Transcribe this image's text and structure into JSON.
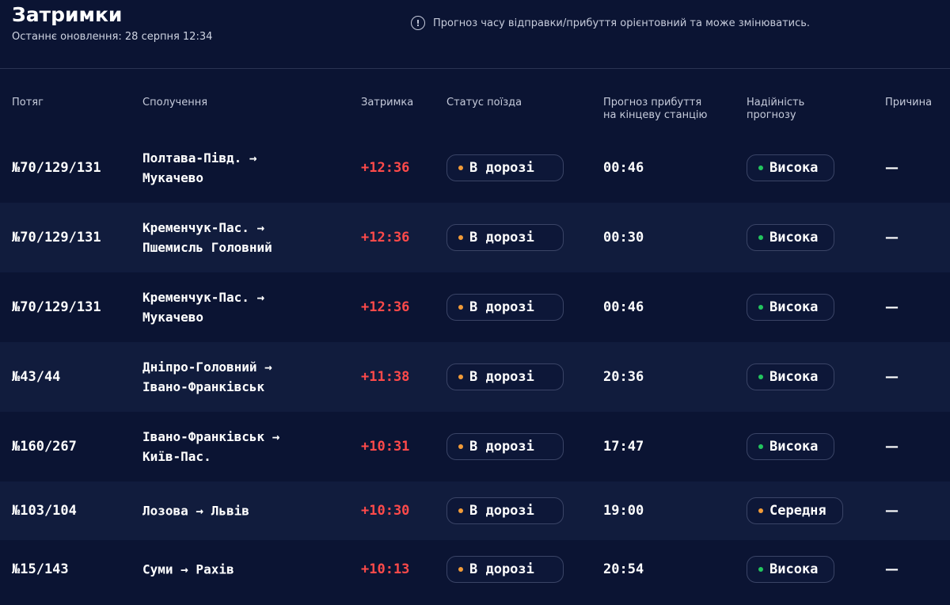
{
  "header": {
    "title": "Затримки",
    "updated": "Останнє оновлення: 28 серпня 12:34",
    "note": "Прогноз часу відправки/прибуття орієнтовний та може змінюватись.",
    "info_icon": "!"
  },
  "columns": {
    "train": "Потяг",
    "route": "Сполучення",
    "delay": "Затримка",
    "status": "Статус поїзда",
    "eta_line1": "Прогноз прибуття",
    "eta_line2": "на кінцеву станцію",
    "reliability_line1": "Надійність",
    "reliability_line2": "прогнозу",
    "reason": "Причина"
  },
  "colors": {
    "status_dot": "#f29b38",
    "high": "#22c55e",
    "medium": "#f29b38"
  },
  "rows": [
    {
      "train": "№70/129/131",
      "route": "Полтава-Півд. → Мукачево",
      "route1": "Полтава-Півд. →",
      "route2": "Мукачево",
      "delay": "+12:36",
      "status": "В дорозі",
      "eta": "00:46",
      "reliability": "Висока",
      "rel_level": "high",
      "reason": "—"
    },
    {
      "train": "№70/129/131",
      "route": "Кременчук-Пас. → Пшемисль Головний",
      "route1": "Кременчук-Пас. →",
      "route2": "Пшемисль Головний",
      "delay": "+12:36",
      "status": "В дорозі",
      "eta": "00:30",
      "reliability": "Висока",
      "rel_level": "high",
      "reason": "—"
    },
    {
      "train": "№70/129/131",
      "route": "Кременчук-Пас. → Мукачево",
      "route1": "Кременчук-Пас. →",
      "route2": "Мукачево",
      "delay": "+12:36",
      "status": "В дорозі",
      "eta": "00:46",
      "reliability": "Висока",
      "rel_level": "high",
      "reason": "—"
    },
    {
      "train": "№43/44",
      "route": "Дніпро-Головний → Івано-Франківськ",
      "route1": "Дніпро-Головний →",
      "route2": "Івано-Франківськ",
      "delay": "+11:38",
      "status": "В дорозі",
      "eta": "20:36",
      "reliability": "Висока",
      "rel_level": "high",
      "reason": "—"
    },
    {
      "train": "№160/267",
      "route": "Івано-Франківськ → Київ-Пас.",
      "route1": "Івано-Франківськ →",
      "route2": "Київ-Пас.",
      "delay": "+10:31",
      "status": "В дорозі",
      "eta": "17:47",
      "reliability": "Висока",
      "rel_level": "high",
      "reason": "—"
    },
    {
      "train": "№103/104",
      "route": "Лозова → Львів",
      "route1": "Лозова → Львів",
      "route2": "",
      "delay": "+10:30",
      "status": "В дорозі",
      "eta": "19:00",
      "reliability": "Середня",
      "rel_level": "medium",
      "reason": "—"
    },
    {
      "train": "№15/143",
      "route": "Суми → Рахів",
      "route1": "Суми → Рахів",
      "route2": "",
      "delay": "+10:13",
      "status": "В дорозі",
      "eta": "20:54",
      "reliability": "Висока",
      "rel_level": "high",
      "reason": "—"
    }
  ]
}
